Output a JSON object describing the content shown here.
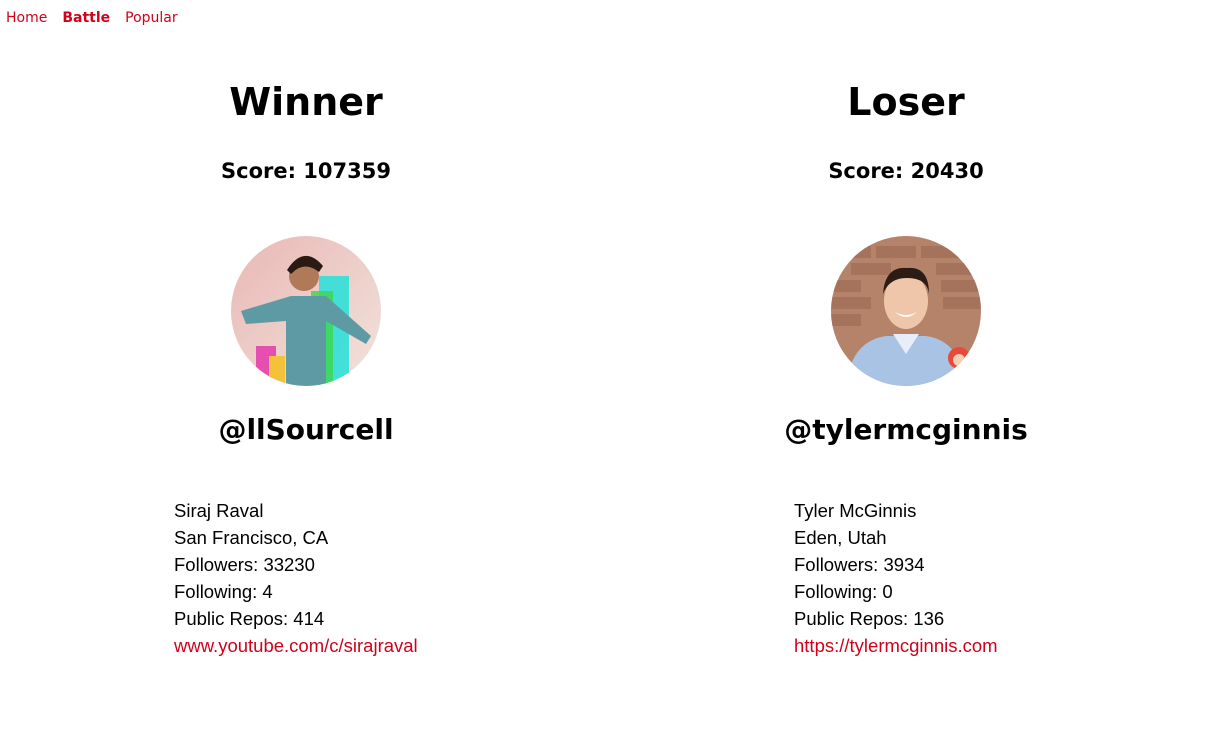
{
  "nav": {
    "items": [
      {
        "label": "Home",
        "active": false
      },
      {
        "label": "Battle",
        "active": true
      },
      {
        "label": "Popular",
        "active": false
      }
    ]
  },
  "colors": {
    "link": "#d0021b"
  },
  "players": [
    {
      "heading": "Winner",
      "score_label": "Score: 107359",
      "handle": "@llSourcell",
      "avatar_icon": "user-photo",
      "name": "Siraj Raval",
      "location": "San Francisco, CA",
      "followers": "Followers: 33230",
      "following": "Following: 4",
      "repos": "Public Repos: 414",
      "blog": "www.youtube.com/c/sirajraval"
    },
    {
      "heading": "Loser",
      "score_label": "Score: 20430",
      "handle": "@tylermcginnis",
      "avatar_icon": "user-photo",
      "name": "Tyler McGinnis",
      "location": "Eden, Utah",
      "followers": "Followers: 3934",
      "following": "Following: 0",
      "repos": "Public Repos: 136",
      "blog": "https://tylermcginnis.com"
    }
  ]
}
